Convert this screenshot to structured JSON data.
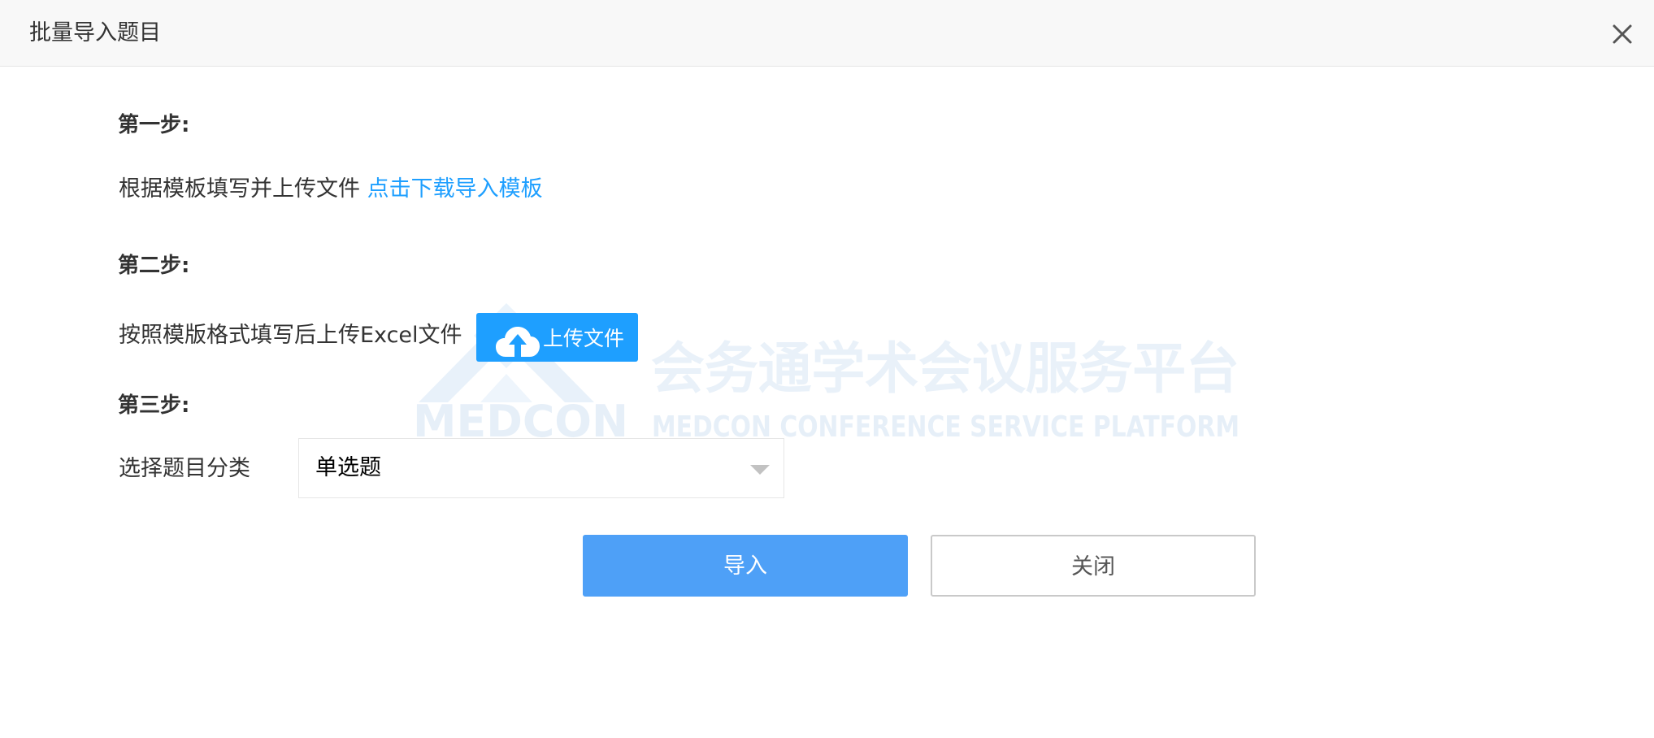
{
  "dialog": {
    "title": "批量导入题目",
    "close_icon": "close-icon"
  },
  "step1": {
    "label": "第一步:",
    "description": "根据模板填写并上传文件",
    "download_link": "点击下载导入模板"
  },
  "step2": {
    "label": "第二步:",
    "description": "按照模版格式填写后上传Excel文件",
    "upload_button": "上传文件",
    "upload_icon": "cloud-upload-icon"
  },
  "step3": {
    "label": "第三步:",
    "description": "选择题目分类",
    "select_value": "单选题",
    "select_icon": "chevron-down-icon"
  },
  "watermark": {
    "cn_text": "会务通学术会议服务平台",
    "logo_text": "MEDCON",
    "en_text": "MEDCON CONFERENCE SERVICE PLATFORM"
  },
  "actions": {
    "import_label": "导入",
    "close_label": "关闭"
  },
  "colors": {
    "accent": "#1e9fff",
    "primary_button": "#4ea0f7",
    "header_bg": "#f8f8f8",
    "text": "#333333"
  }
}
